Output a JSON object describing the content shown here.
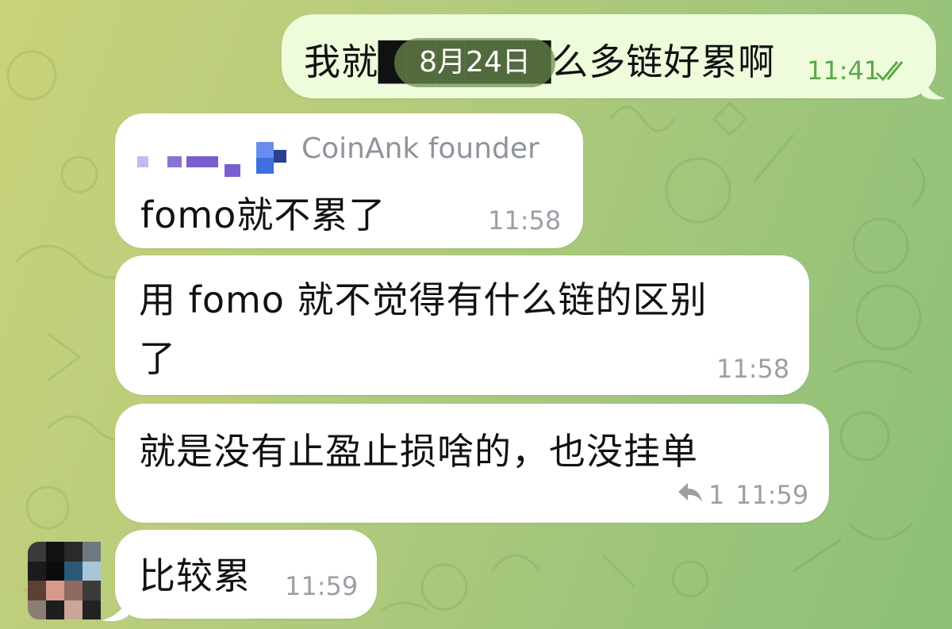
{
  "chat": {
    "date_separator": "8月24日",
    "messages": [
      {
        "direction": "outgoing",
        "text": "我就██████么多链好累啊",
        "time": "11:41",
        "status": "read"
      },
      {
        "direction": "incoming",
        "sender": "CoinAnk founder",
        "text": "fomo就不累了",
        "time": "11:58"
      },
      {
        "direction": "incoming",
        "text_line1": "用 fomo 就不觉得有什么链的区别",
        "text_line2": "了",
        "time": "11:58"
      },
      {
        "direction": "incoming",
        "text": "就是没有止盈止损啥的，也没挂单",
        "reply_count": "1",
        "time": "11:59"
      },
      {
        "direction": "incoming",
        "text": "比较累",
        "time": "11:59"
      }
    ]
  },
  "colors": {
    "bg_left": "#c9d27a",
    "bg_right": "#8dbf77",
    "outgoing_bubble": "#eefcdc",
    "incoming_bubble": "#ffffff",
    "outgoing_time": "#5aa84a",
    "timestamp": "#9aa0a6"
  },
  "icons": [
    "double-check-icon",
    "reply-arrow-icon",
    "avatar-pixelated",
    "sender-avatar-pixelated"
  ]
}
